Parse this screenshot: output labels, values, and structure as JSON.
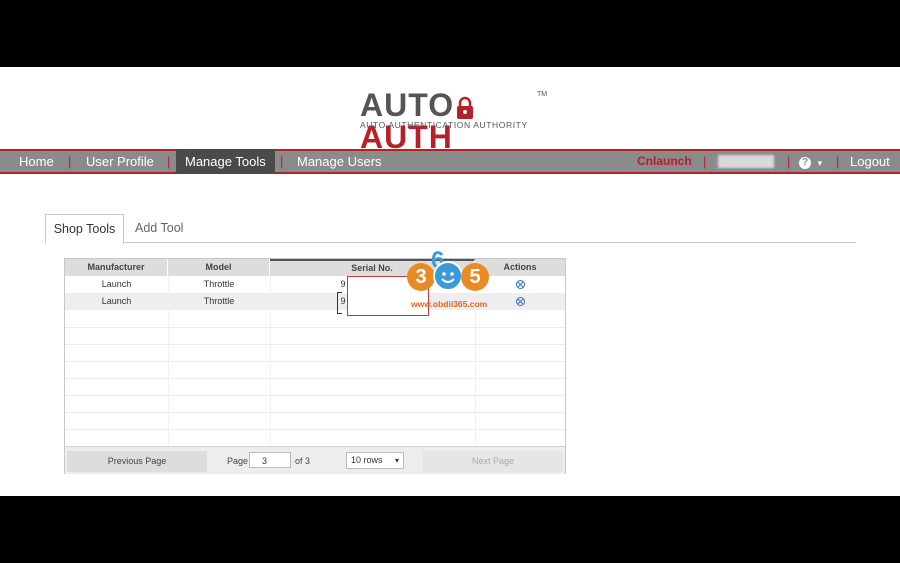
{
  "brand": {
    "logo_part1": "AUTO",
    "logo_part2": "AUTH",
    "trademark": "TM",
    "subtitle": "AUTO AUTHENTICATION AUTHORITY",
    "accent_color": "#b5202a"
  },
  "nav": {
    "items": [
      {
        "label": "Home"
      },
      {
        "label": "User Profile"
      },
      {
        "label": "Manage Tools"
      },
      {
        "label": "Manage Users"
      }
    ],
    "active": "Manage Tools",
    "separator": "|",
    "user": "Cnlaunch",
    "help_icon": "?",
    "help_caret": "▾",
    "logout": "Logout"
  },
  "tabs": [
    {
      "label": "Shop Tools"
    },
    {
      "label": "Add Tool"
    }
  ],
  "grid": {
    "columns": [
      "Manufacturer",
      "Model",
      "Serial No.",
      "Actions"
    ],
    "rows": [
      {
        "manufacturer": "Launch",
        "model": "Throttle",
        "serial": "9"
      },
      {
        "manufacturer": "Launch",
        "model": "Throttle",
        "serial": "9"
      }
    ],
    "action_icon": "remove-icon"
  },
  "pager": {
    "prev": "Previous Page",
    "page_label": "Page",
    "page_value": "3",
    "of_label": "of 3",
    "rows_option": "10 rows",
    "next": "Next Page"
  },
  "watermark": {
    "digit1": "3",
    "digit2": "6",
    "digit3": "5",
    "url": "www.obdii365.com"
  }
}
